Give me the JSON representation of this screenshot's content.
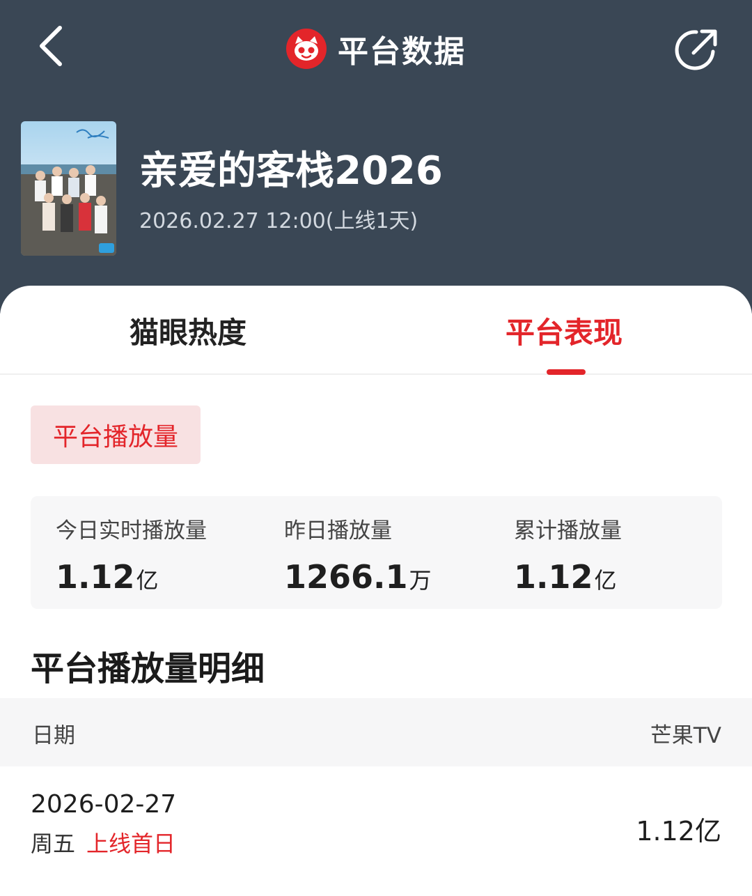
{
  "header": {
    "title": "平台数据",
    "logo_icon": "maoyan-cat-logo",
    "back_icon": "chevron-left-icon",
    "share_icon": "share-icon",
    "bg_color": "#3a4755"
  },
  "show": {
    "title": "亲爱的客栈2026",
    "release": "2026.02.27 12:00(上线1天)"
  },
  "tabs": [
    {
      "label": "猫眼热度",
      "active": false
    },
    {
      "label": "平台表现",
      "active": true
    }
  ],
  "accent_color": "#e3252a",
  "metric_chip": {
    "label": "平台播放量"
  },
  "stats": [
    {
      "label": "今日实时播放量",
      "value": "1.12",
      "unit": "亿"
    },
    {
      "label": "昨日播放量",
      "value": "1266.1",
      "unit": "万"
    },
    {
      "label": "累计播放量",
      "value": "1.12",
      "unit": "亿"
    }
  ],
  "detail": {
    "title": "平台播放量明细",
    "columns": [
      "日期",
      "芒果TV"
    ],
    "rows": [
      {
        "date": "2026-02-27",
        "weekday": "周五",
        "tag": "上线首日",
        "value": "1.12亿"
      }
    ]
  }
}
